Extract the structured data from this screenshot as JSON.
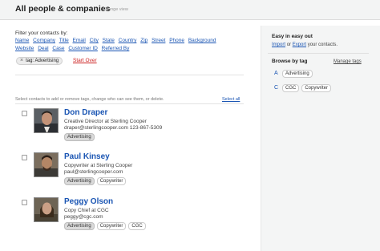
{
  "header": {
    "title": "All people & companies",
    "change_view": "Change view"
  },
  "filter": {
    "label": "Filter your contacts by:",
    "fields": [
      "Name",
      "Company",
      "Title",
      "Email",
      "City",
      "State",
      "Country",
      "Zip",
      "Street",
      "Phone",
      "Background",
      "Website",
      "Deal",
      "Case",
      "Customer ID",
      "Referred By"
    ],
    "active_tag": {
      "close": "×",
      "label": "tag: Advertising"
    },
    "start_over": "Start Over"
  },
  "list": {
    "hint": "Select contacts to add or remove tags, change who can see them, or delete.",
    "select_all": "Select all",
    "contacts": [
      {
        "name": "Don Draper",
        "title": "Creative Director at Sterling Cooper",
        "contact": "draper@sterlingcooper.com    123-867-5309",
        "tags": [
          "Advertising"
        ]
      },
      {
        "name": "Paul Kinsey",
        "title": "Copywriter at Sterling Cooper",
        "contact": "paul@sterlingcooper.com",
        "tags": [
          "Advertising",
          "Copywriter"
        ]
      },
      {
        "name": "Peggy Olson",
        "title": "Copy Chief at CGC",
        "contact": "peggy@cgc.com",
        "tags": [
          "Advertising",
          "Copywriter",
          "CGC"
        ]
      }
    ]
  },
  "sidebar": {
    "easy_title": "Easy in easy out",
    "import": "Import",
    "or": "or",
    "export": "Export",
    "export_suffix": "your contacts.",
    "browse_title": "Browse by tag",
    "manage_tags": "Manage tags",
    "tag_rows": [
      {
        "letter": "A",
        "tags": [
          "Advertising"
        ]
      },
      {
        "letter": "C",
        "tags": [
          "CGC",
          "Copywriter"
        ]
      }
    ]
  }
}
